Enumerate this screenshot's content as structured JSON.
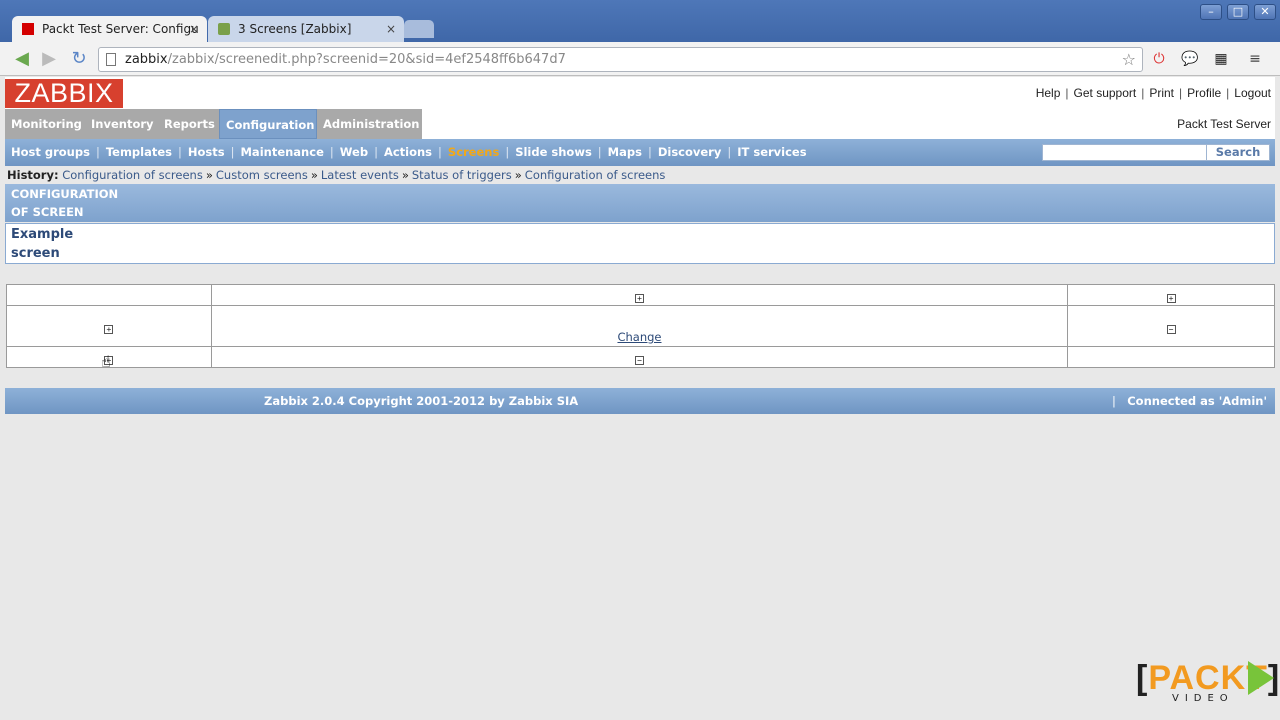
{
  "browser": {
    "tabs": [
      {
        "title": "Packt Test Server: Configu",
        "close": "×"
      },
      {
        "title": "3 Screens [Zabbix]",
        "close": "×"
      }
    ],
    "window_controls": {
      "minimize": "–",
      "maximize": "□",
      "close": "✕"
    },
    "url_host": "zabbix",
    "url_rest": "/zabbix/screenedit.php?screenid=20&sid=4ef2548ff6b647d7"
  },
  "zabbix": {
    "logo": "ZABBIX",
    "top_links": [
      "Help",
      "Get support",
      "Print",
      "Profile",
      "Logout"
    ],
    "main_menu": [
      "Monitoring",
      "Inventory",
      "Reports",
      "Configuration",
      "Administration"
    ],
    "active_main_menu": "Configuration",
    "server_name": "Packt Test Server",
    "sub_menu": [
      "Host groups",
      "Templates",
      "Hosts",
      "Maintenance",
      "Web",
      "Actions",
      "Screens",
      "Slide shows",
      "Maps",
      "Discovery",
      "IT services"
    ],
    "active_sub_menu": "Screens",
    "search_button": "Search",
    "history_label": "History:",
    "history": [
      "Configuration of screens",
      "Custom screens",
      "Latest events",
      "Status of triggers",
      "Configuration of screens"
    ],
    "history_sep": "»",
    "section_title": [
      "CONFIGURATION",
      "OF SCREEN"
    ],
    "screen_name": [
      "Example",
      "screen"
    ],
    "grid": {
      "change_link": "Change",
      "plus": "+",
      "minus": "−"
    },
    "footer_copyright": "Zabbix 2.0.4 Copyright 2001-2012 by Zabbix SIA",
    "footer_sep": "|",
    "footer_connected": "Connected as 'Admin'"
  },
  "watermark": {
    "brand_left": "[",
    "brand": "PACKT",
    "brand_right": "]",
    "sub": "VIDEO"
  },
  "colors": {
    "zabbix_red": "#d7402e",
    "menu_blue": "#7ea2cd",
    "active_submenu": "#f2a818"
  }
}
